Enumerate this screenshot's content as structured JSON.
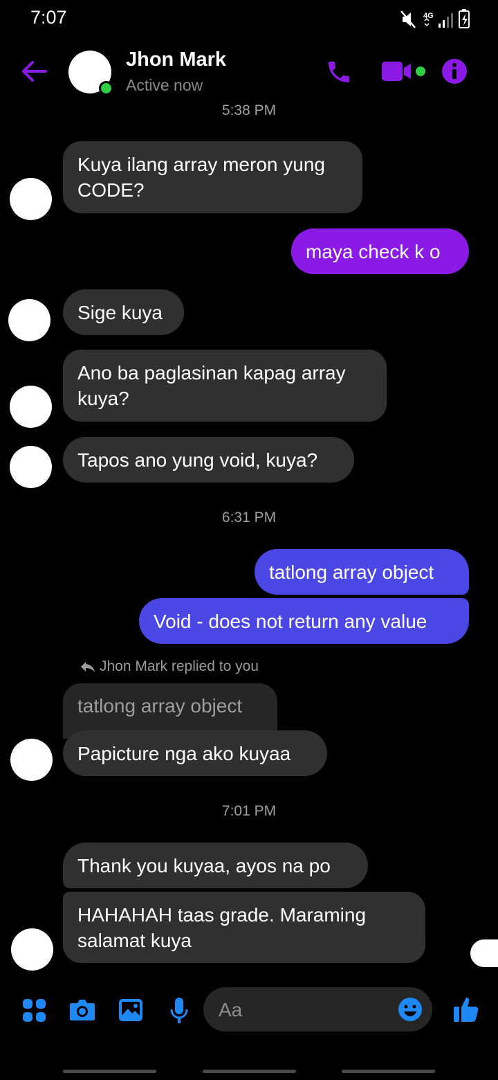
{
  "status_bar": {
    "time": "7:07",
    "network": "4G"
  },
  "header": {
    "contact_name": "Jhon Mark",
    "status": "Active now",
    "accent_color": "#8c1ae6",
    "icons": [
      "back-arrow-icon",
      "phone-icon",
      "video-icon",
      "info-icon"
    ]
  },
  "messages": {
    "ts1": "5:38 PM",
    "m1": "Kuya ilang array meron yung\nCODE?",
    "m2": "maya check k o",
    "m3": "Sige kuya",
    "m4": "Ano ba paglasinan kapag array\nkuya?",
    "m5": "Tapos ano yung void, kuya?",
    "ts2": "6:31 PM",
    "m6": "tatlong array object",
    "m7": "Void - does not return any value",
    "reply_note": "Jhon Mark replied to you",
    "quoted": "tatlong array object",
    "m8": "Papicture nga ako kuyaa",
    "ts3": "7:01 PM",
    "m9": "Thank you kuyaa, ayos na po",
    "m10": "HAHAHAH taas grade. Maraming\nsalamat kuya"
  },
  "composer": {
    "placeholder": "Aa",
    "icons": [
      "apps-icon",
      "camera-icon",
      "gallery-icon",
      "microphone-icon",
      "emoji-icon",
      "thumbs-up-icon"
    ],
    "icon_color": "#1e88f5"
  }
}
